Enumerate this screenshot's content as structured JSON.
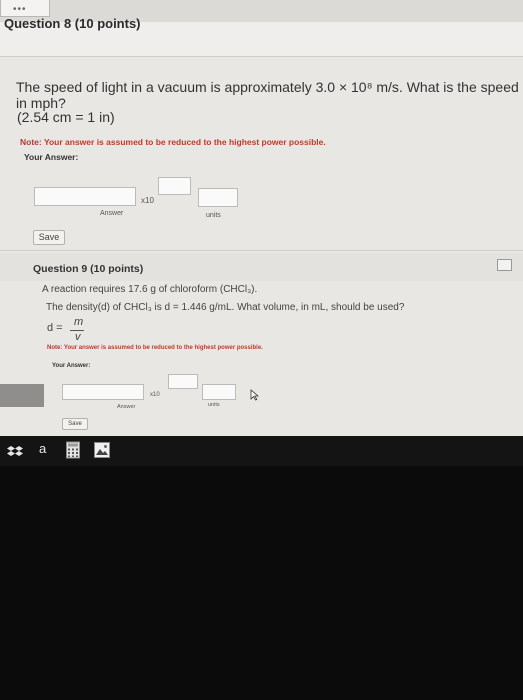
{
  "question8": {
    "title": "Question 8 (10 points)",
    "text": "The speed of light in a vacuum is approximately 3.0 × 10⁸ m/s. What is the speed in mph?",
    "conversion": "(2.54 cm = 1 in)",
    "note_label": "Note:",
    "note_text": " Your answer is assumed to be reduced to the highest power possible.",
    "your_answer": "Your Answer:",
    "x10": "x10",
    "answer_label": "Answer",
    "units_label": "units",
    "save": "Save"
  },
  "question9": {
    "title": "Question 9 (10 points)",
    "line1": "A reaction requires 17.6 g of chloroform (CHCl₃).",
    "line2": "The density(d) of CHCl₃ is d = 1.446 g/mL. What volume, in mL, should be used?",
    "formula_lhs": "d =",
    "formula_num": "m",
    "formula_den": "v",
    "note_label": "Note:",
    "note_text": " Your answer is assumed to be reduced to the highest power possible.",
    "your_answer": "Your Answer:",
    "x10": "x10",
    "answer_label": "Answer",
    "units_label": "units",
    "save": "Save"
  },
  "taskbar": {
    "letter": "a"
  },
  "colors": {
    "screen_bg": "#e9e7e4",
    "note_red": "#c0392b",
    "taskbar_bg": "#141414"
  },
  "icons": [
    "dots-icon",
    "expand-icon",
    "mouse-cursor-icon",
    "dropbox-icon",
    "calculator-icon",
    "image-icon"
  ]
}
